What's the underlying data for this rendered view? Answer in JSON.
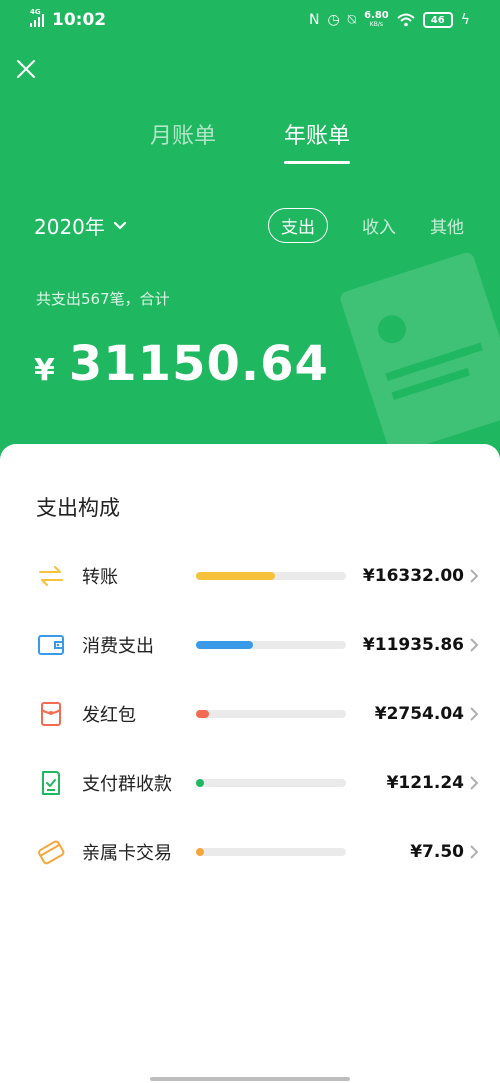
{
  "status": {
    "network": "4G",
    "time": "10:02",
    "speed_value": "6.80",
    "speed_unit": "KB/s",
    "battery": "46"
  },
  "tabs": [
    {
      "label": "月账单",
      "active": false
    },
    {
      "label": "年账单",
      "active": true
    }
  ],
  "year_selector": {
    "label": "2020年"
  },
  "types": [
    {
      "label": "支出",
      "active": true
    },
    {
      "label": "收入",
      "active": false
    },
    {
      "label": "其他",
      "active": false
    }
  ],
  "summary": {
    "text": "共支出567笔，合计",
    "currency": "¥",
    "total": "31150.64"
  },
  "breakdown": {
    "title": "支出构成",
    "items": [
      {
        "label": "转账",
        "amount": "¥16332.00",
        "fraction": 0.524,
        "color": "#f7c13a",
        "icon": "transfer-icon"
      },
      {
        "label": "消费支出",
        "amount": "¥11935.86",
        "fraction": 0.383,
        "color": "#3a9ae8",
        "icon": "wallet-icon"
      },
      {
        "label": "发红包",
        "amount": "¥2754.04",
        "fraction": 0.088,
        "color": "#f26b52",
        "icon": "red-packet-icon"
      },
      {
        "label": "支付群收款",
        "amount": "¥121.24",
        "fraction": 0.004,
        "color": "#1fb860",
        "icon": "group-payment-icon"
      },
      {
        "label": "亲属卡交易",
        "amount": "¥7.50",
        "fraction": 0.0002,
        "color": "#f5a63a",
        "icon": "family-card-icon"
      }
    ]
  },
  "colors": {
    "brand_green": "#1fb860"
  }
}
